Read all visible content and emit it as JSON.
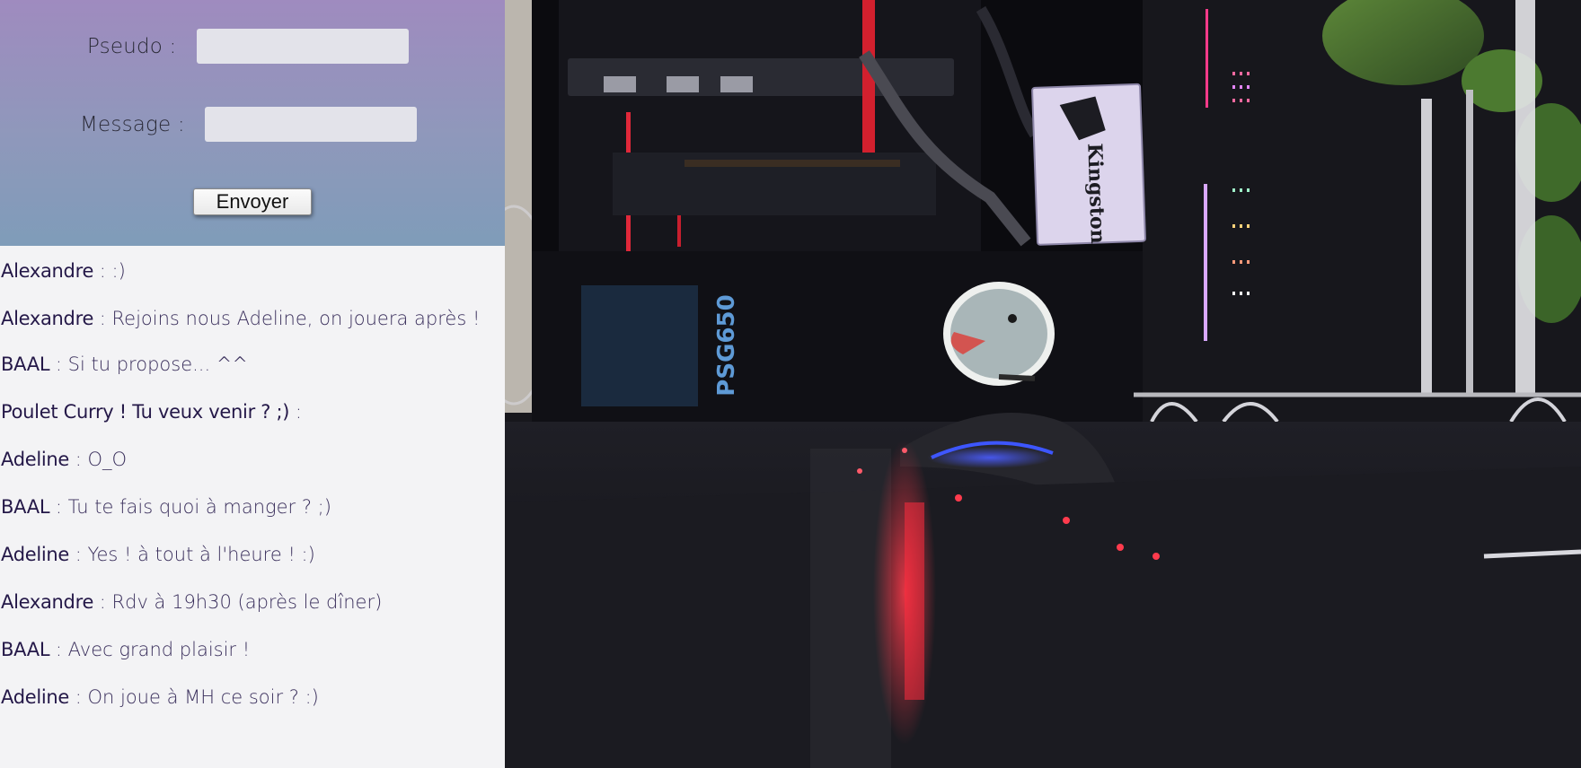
{
  "form": {
    "pseudo_label": "Pseudo :",
    "pseudo_value": "",
    "message_label": "Message :",
    "message_value": "",
    "submit_label": "Envoyer"
  },
  "messages": [
    {
      "author": "Alexandre",
      "text": " : :)"
    },
    {
      "author": "Alexandre",
      "text": " : Rejoins nous Adeline, on jouera après !"
    },
    {
      "author": "BAAL",
      "text": " : Si tu propose... ^^"
    },
    {
      "author": "Poulet Curry ! Tu veux venir ? ;)",
      "text": " :"
    },
    {
      "author": "Adeline",
      "text": " : O_O"
    },
    {
      "author": "BAAL",
      "text": " : Tu te fais quoi à manger ? ;)"
    },
    {
      "author": "Adeline",
      "text": " : Yes ! à tout à l'heure ! :)"
    },
    {
      "author": "Alexandre",
      "text": " : Rdv à 19h30 (après le dîner)"
    },
    {
      "author": "BAAL",
      "text": " : Avec grand plaisir !"
    },
    {
      "author": "Adeline",
      "text": " : On joue à MH ce soir ? :)"
    }
  ],
  "background": {
    "ssd_brand": "Kingston",
    "psu_label": "PSG650"
  },
  "colors": {
    "form_gradient_top": "#9f8bbf",
    "form_gradient_bottom": "#7f9cb9",
    "chat_background": "#f3f3f5",
    "author_color": "#241848",
    "message_color": "#3a2f5c"
  }
}
